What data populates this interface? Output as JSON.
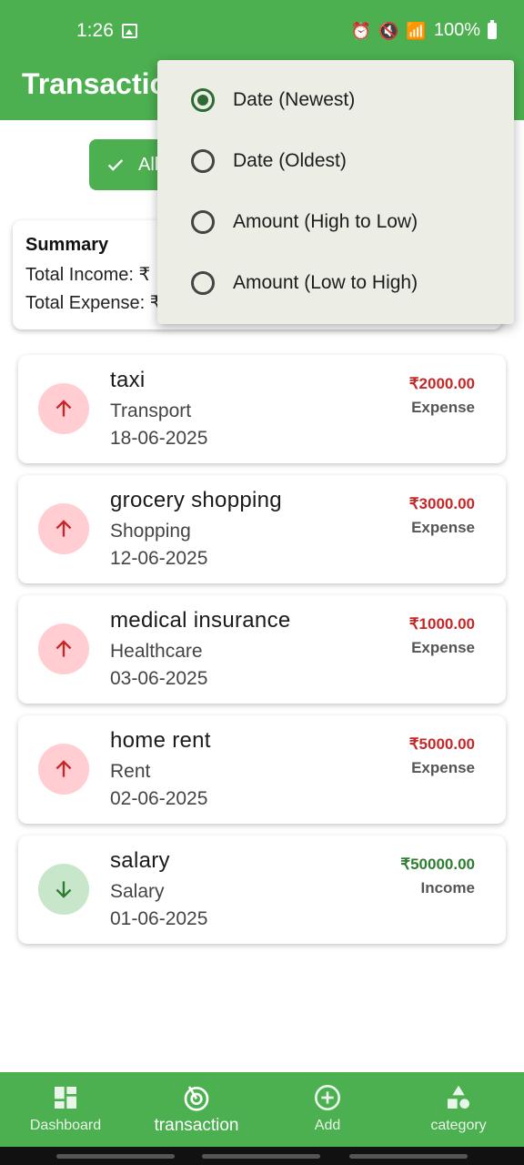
{
  "status_bar": {
    "time": "1:26",
    "battery": "100%"
  },
  "app_bar": {
    "title": "Transactions"
  },
  "filter_chip": {
    "label": "All"
  },
  "summary": {
    "title": "Summary",
    "income_label": "Total Income: ₹",
    "expense_label": "Total Expense: ₹"
  },
  "transactions": [
    {
      "name": "taxi",
      "category": "Transport",
      "date": "18-06-2025",
      "amount": "₹2000.00",
      "type": "Expense"
    },
    {
      "name": "grocery shopping",
      "category": "Shopping",
      "date": "12-06-2025",
      "amount": "₹3000.00",
      "type": "Expense"
    },
    {
      "name": "medical insurance",
      "category": "Healthcare",
      "date": "03-06-2025",
      "amount": "₹1000.00",
      "type": "Expense"
    },
    {
      "name": "home rent",
      "category": "Rent",
      "date": "02-06-2025",
      "amount": "₹5000.00",
      "type": "Expense"
    },
    {
      "name": "salary",
      "category": "Salary",
      "date": "01-06-2025",
      "amount": "₹50000.00",
      "type": "Income"
    }
  ],
  "sort_menu": {
    "selected": "Date (Newest)",
    "options": [
      "Date (Newest)",
      "Date (Oldest)",
      "Amount (High to Low)",
      "Amount (Low to High)"
    ]
  },
  "bottom_nav": {
    "active": "transaction",
    "items": [
      {
        "label": "Dashboard",
        "icon": "dashboard-icon"
      },
      {
        "label": "transaction",
        "icon": "transaction-icon"
      },
      {
        "label": "Add",
        "icon": "add-circle-icon"
      },
      {
        "label": "category",
        "icon": "category-icon"
      }
    ]
  },
  "colors": {
    "primary": "#4CAF50",
    "expense": "#C62828",
    "income": "#2E7D32",
    "menu_bg": "#ECEEE6"
  }
}
